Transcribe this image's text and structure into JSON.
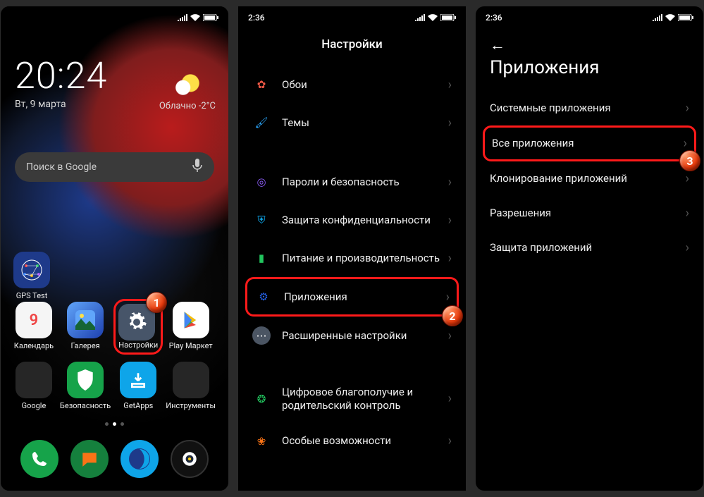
{
  "screen1": {
    "status_time": "",
    "clock_time": "20:24",
    "clock_date": "Вт, 9 марта",
    "weather_text": "Облачно",
    "weather_temp": "-2°C",
    "search_placeholder": "Поиск в Google",
    "apps": {
      "gps": "GPS Test",
      "calendar": "Календарь",
      "gallery": "Галерея",
      "settings": "Настройки",
      "play": "Play Маркет",
      "google_folder": "Google",
      "security": "Безопасность",
      "getapps": "GetApps",
      "tools_folder": "Инструменты"
    },
    "calendar_day": "9"
  },
  "screen2": {
    "status_time": "2:36",
    "title": "Настройки",
    "items": [
      {
        "label": "Обои",
        "icon_color": "#ef5846"
      },
      {
        "label": "Темы",
        "icon_color": "#2aa8ff"
      },
      {
        "label": "Пароли и безопасность",
        "icon_color": "#8b5cf6"
      },
      {
        "label": "Защита конфиденциальности",
        "icon_color": "#0ea5e9"
      },
      {
        "label": "Питание и производительность",
        "icon_color": "#22c55e"
      },
      {
        "label": "Приложения",
        "icon_color": "#2563eb"
      },
      {
        "label": "Расширенные настройки",
        "icon_color": "#4b5563"
      },
      {
        "label": "Цифровое благополучие и родительский контроль",
        "icon_color": "#22c55e"
      },
      {
        "label": "Особые возможности",
        "icon_color": "#f97316"
      }
    ]
  },
  "screen3": {
    "status_time": "2:36",
    "title": "Приложения",
    "items": [
      {
        "label": "Системные приложения"
      },
      {
        "label": "Все приложения"
      },
      {
        "label": "Клонирование приложений"
      },
      {
        "label": "Разрешения"
      },
      {
        "label": "Защита приложений"
      }
    ]
  },
  "badges": {
    "b1": "1",
    "b2": "2",
    "b3": "3"
  }
}
